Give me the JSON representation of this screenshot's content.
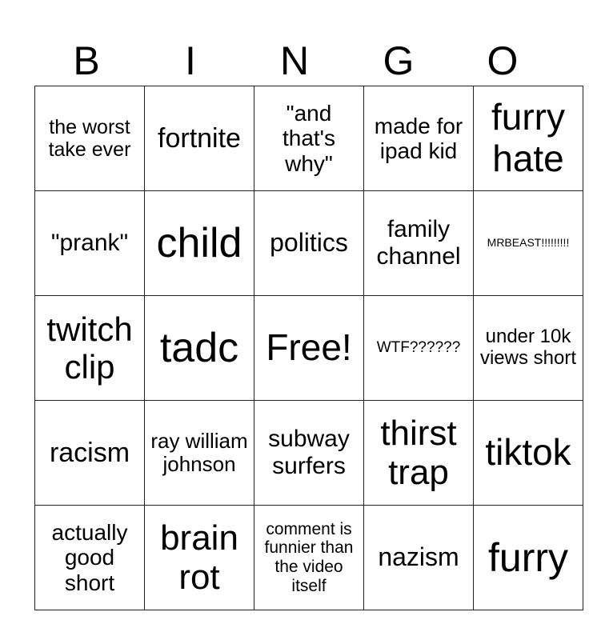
{
  "header": [
    "B",
    "I",
    "N",
    "G",
    "O"
  ],
  "rows": [
    [
      {
        "t": "the worst take ever",
        "s": 25
      },
      {
        "t": "fortnite",
        "s": 34
      },
      {
        "t": "\"and that's why\"",
        "s": 28
      },
      {
        "t": "made for ipad kid",
        "s": 28
      },
      {
        "t": "furry hate",
        "s": 46
      }
    ],
    [
      {
        "t": "\"prank\"",
        "s": 30
      },
      {
        "t": "child",
        "s": 52
      },
      {
        "t": "politics",
        "s": 32
      },
      {
        "t": "family channel",
        "s": 30
      },
      {
        "t": "MRBEAST!!!!!!!!!",
        "s": 14
      }
    ],
    [
      {
        "t": "twitch clip",
        "s": 42
      },
      {
        "t": "tadc",
        "s": 52
      },
      {
        "t": "Free!",
        "s": 46
      },
      {
        "t": "WTF??????",
        "s": 19
      },
      {
        "t": "under 10k views short",
        "s": 24
      }
    ],
    [
      {
        "t": "racism",
        "s": 34
      },
      {
        "t": "ray william johnson",
        "s": 26
      },
      {
        "t": "subway surfers",
        "s": 30
      },
      {
        "t": "thirst trap",
        "s": 44
      },
      {
        "t": "tiktok",
        "s": 46
      }
    ],
    [
      {
        "t": "actually good short",
        "s": 28
      },
      {
        "t": "brain rot",
        "s": 44
      },
      {
        "t": "comment is funnier than the video itself",
        "s": 21
      },
      {
        "t": "nazism",
        "s": 32
      },
      {
        "t": "furry",
        "s": 50
      }
    ]
  ]
}
